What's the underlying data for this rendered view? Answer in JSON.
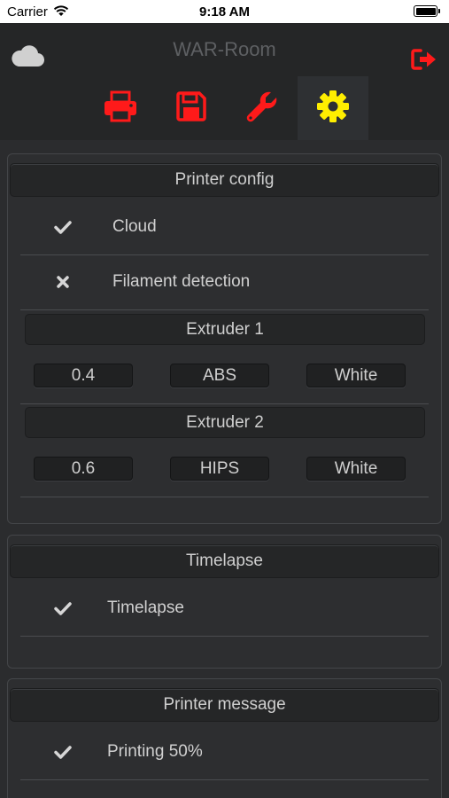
{
  "status_bar": {
    "carrier": "Carrier",
    "time": "9:18 AM"
  },
  "app": {
    "title": "WAR-Room",
    "accent_color": "#ff1a1a",
    "active_tab_color": "#ffee00",
    "tabs": [
      {
        "icon": "print-icon",
        "active": false
      },
      {
        "icon": "save-icon",
        "active": false
      },
      {
        "icon": "wrench-icon",
        "active": false
      },
      {
        "icon": "gear-icon",
        "active": true
      }
    ]
  },
  "printer_config": {
    "header": "Printer config",
    "items": [
      {
        "state": "checked",
        "label": "Cloud"
      },
      {
        "state": "unchecked",
        "label": "Filament detection"
      }
    ],
    "extruder1": {
      "header": "Extruder 1",
      "nozzle": "0.4",
      "material": "ABS",
      "color": "White"
    },
    "extruder2": {
      "header": "Extruder 2",
      "nozzle": "0.6",
      "material": "HIPS",
      "color": "White"
    }
  },
  "timelapse": {
    "header": "Timelapse",
    "items": [
      {
        "state": "checked",
        "label": "Timelapse"
      }
    ]
  },
  "printer_message": {
    "header": "Printer message",
    "items": [
      {
        "state": "checked",
        "label": "Printing 50%"
      }
    ]
  }
}
